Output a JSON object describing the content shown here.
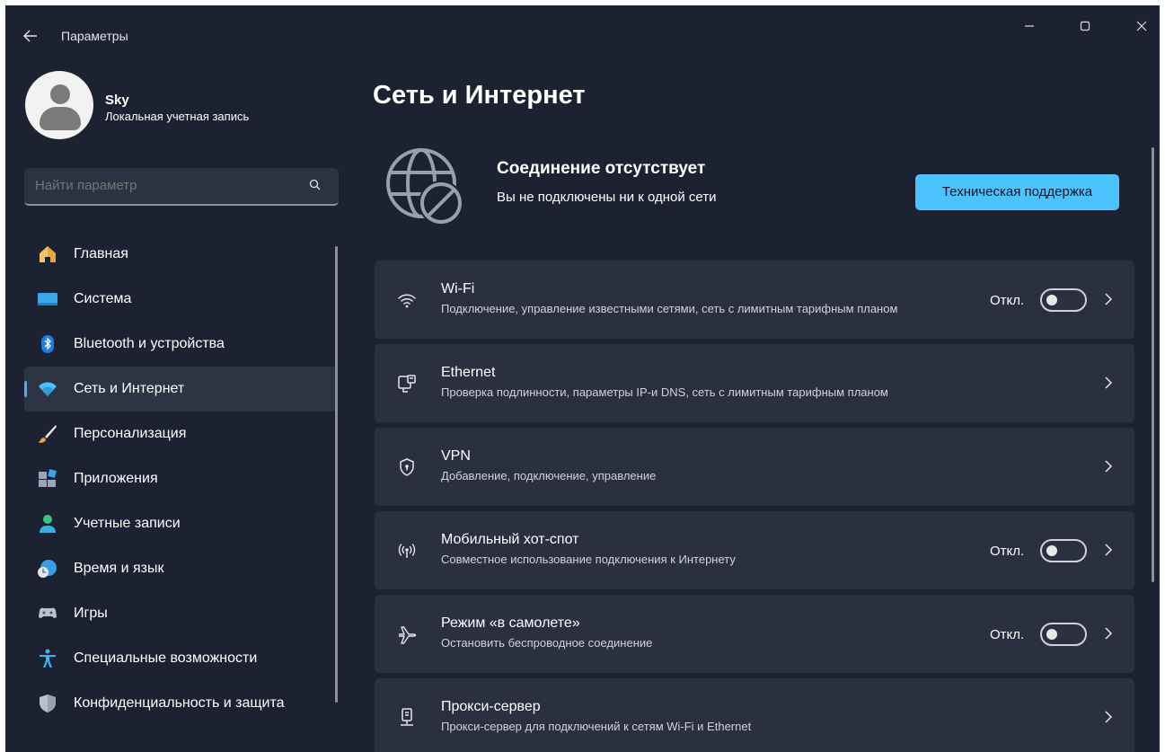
{
  "window": {
    "title": "Параметры",
    "controls": {
      "minimize": "—",
      "maximize": "☐",
      "close": "✕"
    }
  },
  "profile": {
    "name": "Sky",
    "account_type": "Локальная учетная запись"
  },
  "search": {
    "placeholder": "Найти параметр"
  },
  "sidebar": {
    "items": [
      {
        "label": "Главная",
        "icon": "home-icon"
      },
      {
        "label": "Система",
        "icon": "system-icon"
      },
      {
        "label": "Bluetooth и устройства",
        "icon": "bluetooth-icon"
      },
      {
        "label": "Сеть и Интернет",
        "icon": "wifi-icon",
        "active": true
      },
      {
        "label": "Персонализация",
        "icon": "brush-icon"
      },
      {
        "label": "Приложения",
        "icon": "apps-icon"
      },
      {
        "label": "Учетные записи",
        "icon": "account-icon"
      },
      {
        "label": "Время и язык",
        "icon": "time-language-icon"
      },
      {
        "label": "Игры",
        "icon": "gamepad-icon"
      },
      {
        "label": "Специальные возможности",
        "icon": "accessibility-icon"
      },
      {
        "label": "Конфиденциальность и защита",
        "icon": "shield-icon"
      }
    ]
  },
  "main": {
    "title": "Сеть и Интернет",
    "status": {
      "title": "Соединение отсутствует",
      "subtitle": "Вы не подключены ни к одной сети",
      "support_button": "Техническая поддержка"
    },
    "cards": [
      {
        "title": "Wi-Fi",
        "desc": "Подключение, управление известными сетями, сеть с лимитным тарифным планом",
        "toggle": "Откл.",
        "toggle_on": false,
        "icon": "wifi-icon"
      },
      {
        "title": "Ethernet",
        "desc": "Проверка подлинности, параметры IP-и DNS, сеть с лимитным тарифным планом",
        "icon": "ethernet-icon"
      },
      {
        "title": "VPN",
        "desc": "Добавление, подключение, управление",
        "icon": "vpn-shield-icon"
      },
      {
        "title": "Мобильный хот-спот",
        "desc": "Совместное использование подключения к Интернету",
        "toggle": "Откл.",
        "toggle_on": false,
        "icon": "hotspot-icon"
      },
      {
        "title": "Режим «в самолете»",
        "desc": "Остановить беспроводное соединение",
        "toggle": "Откл.",
        "toggle_on": false,
        "icon": "airplane-icon"
      },
      {
        "title": "Прокси-сервер",
        "desc": "Прокси-сервер для подключений к сетям Wi-Fi и Ethernet",
        "icon": "proxy-icon"
      }
    ]
  },
  "colors": {
    "background": "#1c2231",
    "card": "#2a3040",
    "accent": "#4cc2ff",
    "active_indicator": "#3ab5ef"
  }
}
